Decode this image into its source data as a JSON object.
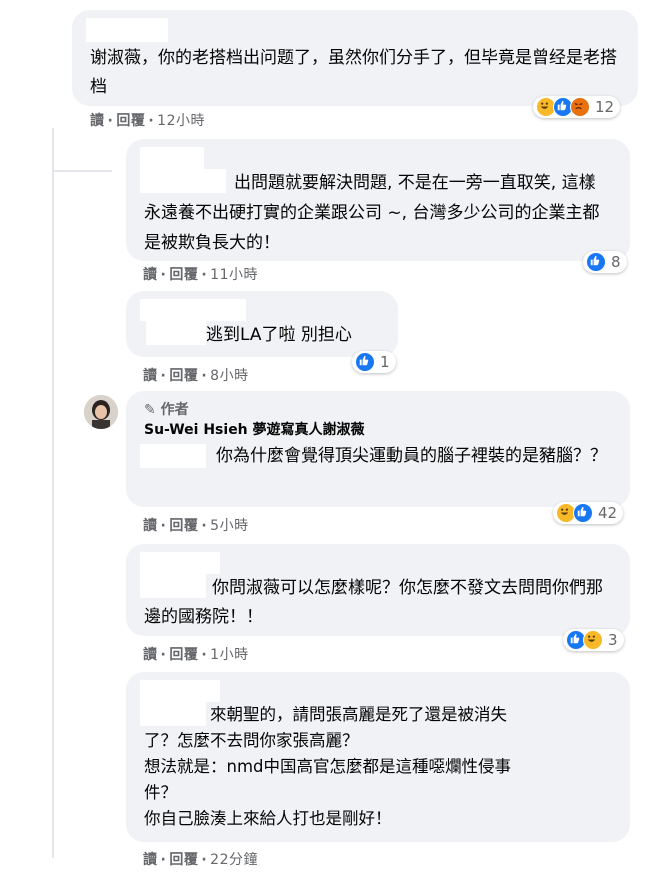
{
  "actions": {
    "read": "讀",
    "reply": "回覆",
    "dot": "·"
  },
  "comments": [
    {
      "text": "谢淑薇，你的老搭档出问题了，虽然你们分手了，但毕竟是曾经是老搭档",
      "time": "12小時",
      "reaction_count": "12",
      "reactions": [
        "haha-icon",
        "like-icon",
        "angry-icon"
      ]
    },
    {
      "text": "出問題就要解決問題, 不是在一旁一直取笑, 這樣永遠養不出硬打實的企業跟公司 ~, 台灣多少公司的企業主都是被欺負長大的！",
      "time": "11小時",
      "reaction_count": "8",
      "reactions": [
        "like-icon"
      ]
    },
    {
      "text": "逃到LA了啦 別担心",
      "time": "8小時",
      "reaction_count": "1",
      "reactions": [
        "like-icon"
      ]
    },
    {
      "badge": "作者",
      "author": "Su-Wei Hsieh 夢遊寫真人謝淑薇",
      "text": "你為什麼會覺得頂尖運動員的腦子裡裝的是豬腦？？",
      "time": "5小時",
      "reaction_count": "42",
      "reactions": [
        "haha-icon",
        "like-icon"
      ]
    },
    {
      "text": "你問淑薇可以怎麼樣呢？你怎麼不發文去問問你們那邊的國務院！！",
      "time": "1小時",
      "reaction_count": "3",
      "reactions": [
        "like-icon",
        "haha-icon"
      ]
    },
    {
      "text_lines": [
        "來朝聖的，請問張高麗是死了還是被消失",
        "了？怎麼不去問你家張高麗？",
        "想法就是：nmd中国高官怎麼都是這種噁爛性侵事",
        "件？",
        "你自己臉湊上來給人打也是剛好！"
      ],
      "time": "22分鐘"
    }
  ],
  "colors": {
    "bubble": "#f0f2f5",
    "meta": "#65676b",
    "like": "#1877f2",
    "haha": "#f7b928",
    "angry": "#e9710f"
  }
}
